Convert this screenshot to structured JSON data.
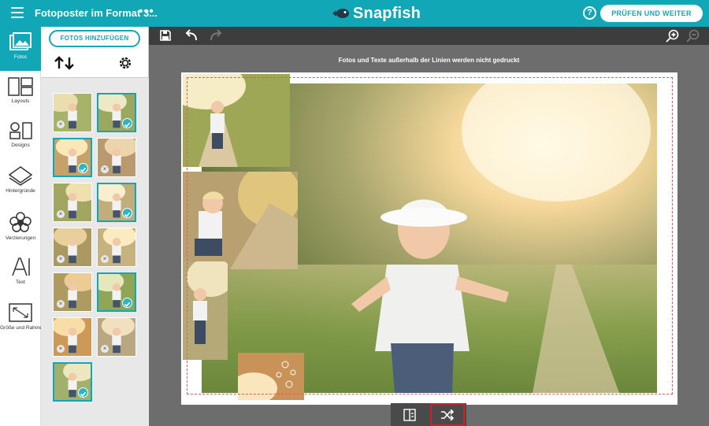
{
  "header": {
    "document_title": "Fotoposter im Format 3...",
    "brand_name": "Snapfish",
    "help_symbol": "?",
    "review_button_label": "PRÜFEN UND WEITER",
    "background_color": "#12a7b6"
  },
  "left_nav": {
    "items": [
      {
        "label": "Fotos",
        "icon": "photos-icon",
        "active": true
      },
      {
        "label": "Layouts",
        "icon": "layouts-icon",
        "active": false
      },
      {
        "label": "Designs",
        "icon": "designs-icon",
        "active": false
      },
      {
        "label": "Hintergründe",
        "icon": "backgrounds-icon",
        "active": false
      },
      {
        "label": "Verzierungen",
        "icon": "embellishments-icon",
        "active": false
      },
      {
        "label": "Text",
        "icon": "text-icon",
        "active": false
      },
      {
        "label": "Größe und Rahmen",
        "icon": "size-frame-icon",
        "active": false
      }
    ]
  },
  "photos_panel": {
    "add_button_label": "FOTOS HINZUFÜGEN",
    "thumbnails": [
      {
        "status": "remove",
        "selected": false
      },
      {
        "status": "check",
        "selected": true
      },
      {
        "status": "check",
        "selected": true
      },
      {
        "status": "remove",
        "selected": false
      },
      {
        "status": "remove",
        "selected": false
      },
      {
        "status": "check",
        "selected": true
      },
      {
        "status": "remove",
        "selected": false
      },
      {
        "status": "remove",
        "selected": false
      },
      {
        "status": "remove",
        "selected": false
      },
      {
        "status": "check",
        "selected": true
      },
      {
        "status": "remove",
        "selected": false
      },
      {
        "status": "remove",
        "selected": false
      },
      {
        "status": "check",
        "selected": true
      }
    ]
  },
  "toolbar": {
    "icons": [
      "save-icon",
      "undo-icon",
      "redo-icon",
      "zoom-in-icon",
      "zoom-out-icon"
    ]
  },
  "canvas": {
    "print_notice": "Fotos und Texte außerhalb der Linien werden nicht gedruckt",
    "guide_color": "#e05a6a"
  },
  "bottom_bar": {
    "icons": [
      "layout-swap-icon",
      "shuffle-icon"
    ],
    "highlight_color": "#d21f2e"
  }
}
